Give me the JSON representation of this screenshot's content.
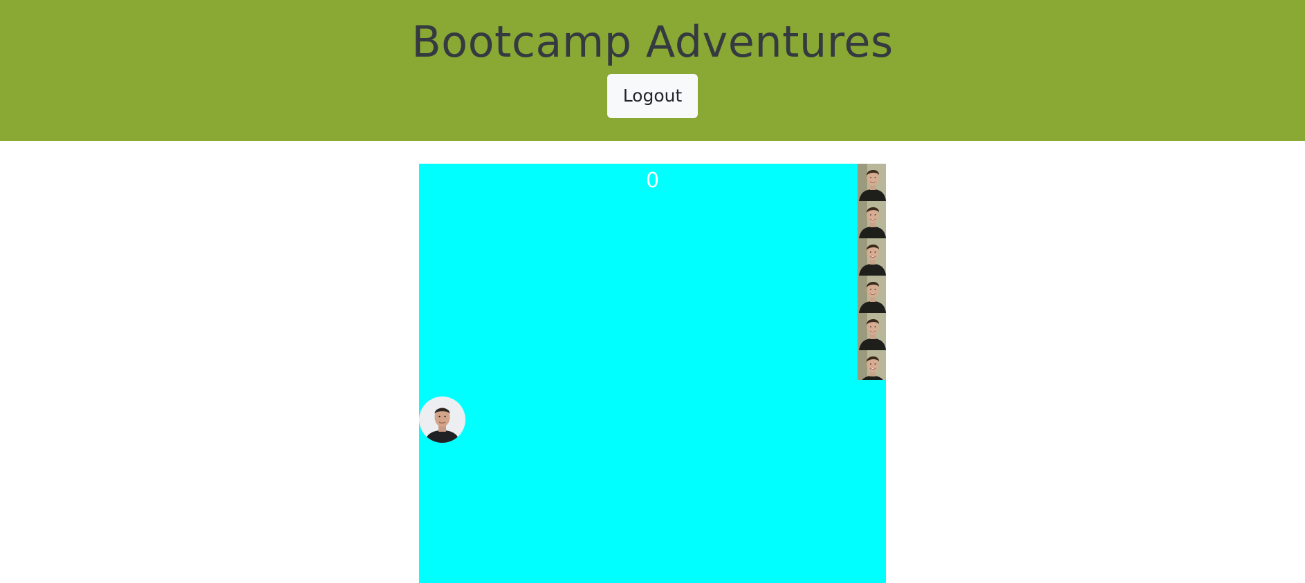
{
  "header": {
    "title": "Bootcamp Adventures",
    "logout_label": "Logout",
    "background_color": "#89a834"
  },
  "game": {
    "score": "0",
    "board_color": "#00ffff",
    "player": {
      "image": "player-avatar-photo"
    },
    "enemies": [
      {
        "image": "enemy-face-photo"
      },
      {
        "image": "enemy-face-photo"
      },
      {
        "image": "enemy-face-photo"
      },
      {
        "image": "enemy-face-photo"
      },
      {
        "image": "enemy-face-photo"
      },
      {
        "image": "enemy-face-photo"
      }
    ]
  }
}
